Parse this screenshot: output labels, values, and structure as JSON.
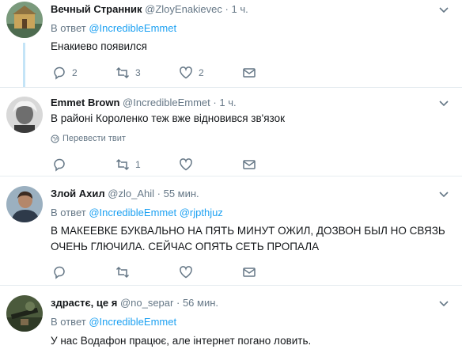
{
  "tweets": [
    {
      "name": "Вечный Странник",
      "handle": "@ZloyEnakievec",
      "dot": "·",
      "time": "1 ч.",
      "reply_prefix": "В ответ",
      "reply_to": [
        "@IncredibleEmmet"
      ],
      "text": "Енакиево появился",
      "replies": "2",
      "retweets": "3",
      "likes": "2"
    },
    {
      "name": "Emmet Brown",
      "handle": "@IncredibleEmmet",
      "dot": "·",
      "time": "1 ч.",
      "text": "В районі Короленко теж вже відновився зв'язок",
      "translate": "Перевести твит",
      "replies": "",
      "retweets": "1",
      "likes": ""
    },
    {
      "name": "Злой Ахил",
      "handle": "@zlo_Ahil",
      "dot": "·",
      "time": "55 мин.",
      "reply_prefix": "В ответ",
      "reply_to": [
        "@IncredibleEmmet",
        "@rjpthjuz"
      ],
      "text_line1": "В МАКЕЕВКЕ БУКВАЛЬНО НА ПЯТЬ МИНУТ ОЖИЛ, ДОЗВОН БЫЛ НО СВЯЗЬ",
      "text_line2": "ОЧЕНЬ ГЛЮЧИЛА. СЕЙЧАС ОПЯТЬ СЕТЬ ПРОПАЛА",
      "replies": "",
      "retweets": "",
      "likes": ""
    },
    {
      "name": "здрастє, це я",
      "handle": "@no_separ",
      "dot": "·",
      "time": "56 мин.",
      "reply_prefix": "В ответ",
      "reply_to": [
        "@IncredibleEmmet"
      ],
      "text": "У нас Водафон працює, але інтернет погано ловить."
    }
  ],
  "colors": {
    "accent": "#1da1f2",
    "secondary_text": "#657786",
    "separator": "#e6ecf0",
    "thread_line": "#c4e4f7"
  }
}
